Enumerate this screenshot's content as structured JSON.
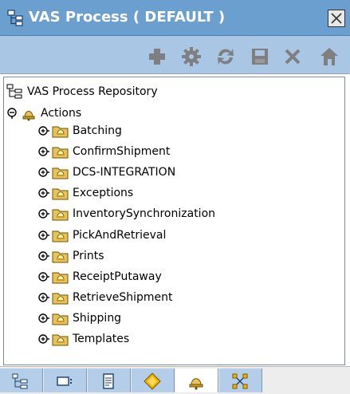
{
  "window": {
    "title": "VAS Process ( DEFAULT )"
  },
  "toolbar": {
    "buttons": [
      {
        "icon": "add-icon"
      },
      {
        "icon": "gear-icon"
      },
      {
        "icon": "refresh-icon"
      },
      {
        "icon": "save-icon"
      },
      {
        "icon": "delete-icon"
      },
      {
        "icon": "home-icon"
      }
    ]
  },
  "tree": {
    "root": {
      "label": "VAS Process Repository",
      "icon": "repository-icon"
    },
    "actions": {
      "label": "Actions",
      "expanded": true,
      "icon": "bell-folder-icon"
    },
    "children": [
      {
        "label": "Batching"
      },
      {
        "label": "ConfirmShipment"
      },
      {
        "label": "DCS-INTEGRATION"
      },
      {
        "label": "Exceptions"
      },
      {
        "label": "InventorySynchronization"
      },
      {
        "label": "PickAndRetrieval"
      },
      {
        "label": "Prints"
      },
      {
        "label": "ReceiptPutaway"
      },
      {
        "label": "RetrieveShipment"
      },
      {
        "label": "Shipping"
      },
      {
        "label": "Templates"
      }
    ]
  },
  "bottom_tabs": [
    {
      "icon": "hierarchy-icon",
      "active": false
    },
    {
      "icon": "window-icon",
      "active": false
    },
    {
      "icon": "document-icon",
      "active": false
    },
    {
      "icon": "diamond-icon",
      "active": false
    },
    {
      "icon": "bell-icon",
      "active": true
    },
    {
      "icon": "network-icon",
      "active": false
    }
  ],
  "colors": {
    "titlebar": "#6b9fcf",
    "toolbar": "#a9c6e4",
    "folder": "#e8c25a"
  }
}
